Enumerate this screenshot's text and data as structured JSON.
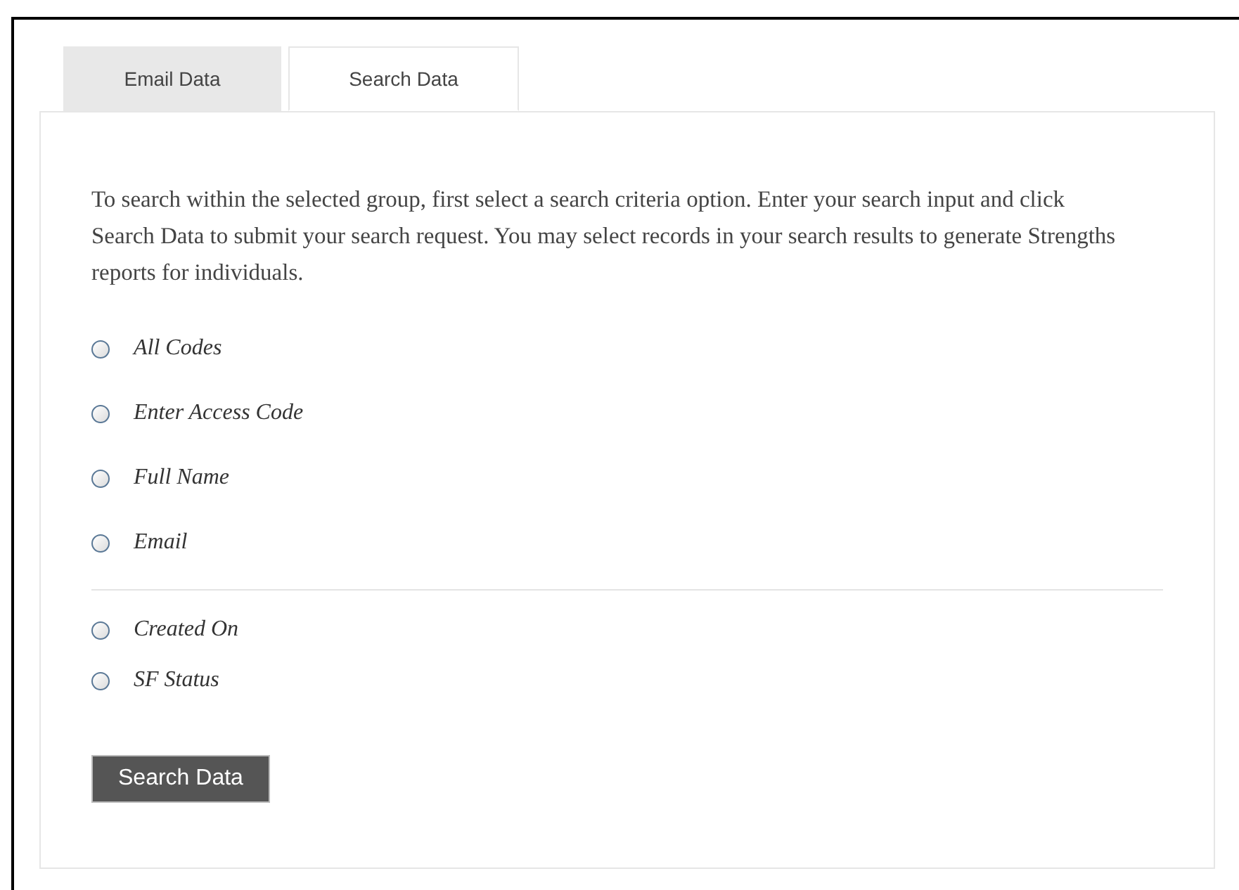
{
  "tabs": [
    {
      "label": "Email Data",
      "selected": false
    },
    {
      "label": "Search Data",
      "selected": true
    }
  ],
  "intro": "To search within the selected group, first select a search criteria option. Enter your search input and click Search Data to submit your search request. You may select records in your search results to generate Strengths reports for individuals.",
  "option_groups": [
    [
      {
        "label": "All Codes",
        "selected": false
      },
      {
        "label": "Enter Access Code",
        "selected": false
      },
      {
        "label": "Full Name",
        "selected": false
      },
      {
        "label": "Email",
        "selected": false
      }
    ],
    [
      {
        "label": "Created On",
        "selected": false
      },
      {
        "label": "SF Status",
        "selected": false
      }
    ]
  ],
  "submit_button": "Search Data"
}
